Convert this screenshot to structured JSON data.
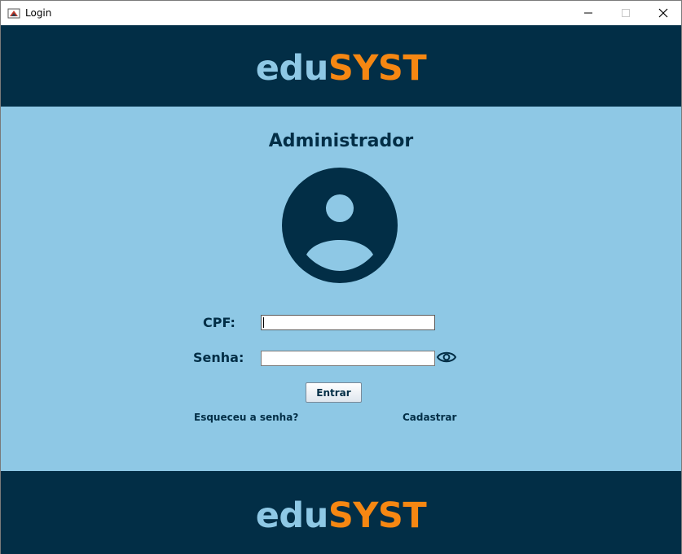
{
  "window": {
    "title": "Login",
    "minimize_glyph": "—",
    "maximize_glyph": "☐",
    "close_glyph": "✕"
  },
  "header": {
    "logo_edu": "edu",
    "logo_syst": "SYST"
  },
  "main": {
    "heading": "Administrador",
    "avatar_icon": "user-avatar-icon",
    "cpf_label": "CPF:",
    "cpf_value": "",
    "senha_label": "Senha:",
    "senha_value": "",
    "show_password_icon": "eye-icon",
    "entrar_label": "Entrar",
    "forgot_label": "Esqueceu a senha?",
    "register_label": "Cadastrar"
  },
  "footer": {
    "logo_edu": "edu",
    "logo_syst": "SYST"
  },
  "colors": {
    "navy": "#022e46",
    "light_blue": "#8ec8e5",
    "orange": "#f68712"
  }
}
